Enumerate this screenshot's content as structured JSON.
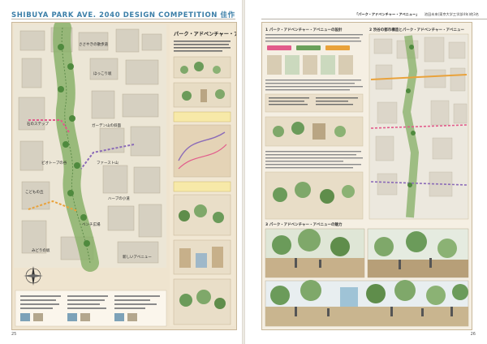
{
  "header": {
    "left_title": "SHIBUYA PARK AVE. 2040 DESIGN COMPETITION 佳作",
    "right_title": "「パーク・アドベンチャー・アベニュー」",
    "right_team": "池田未来(東京大学工学部4年)他3名"
  },
  "footer": {
    "left_page": "25",
    "right_page": "26"
  },
  "left_board": {
    "title": "パーク・アドベンチャー・アベニュー",
    "map_labels": {
      "a": "ささやきの散歩道",
      "b": "ほっこり坂",
      "c": "石のステップ",
      "d": "ガーデン山の斜面",
      "e": "ビオトープの谷",
      "f": "ファースト山",
      "g": "こどもの丘",
      "h": "ハーブの小道",
      "i": "ベンチ広場",
      "j": "みどりの坂",
      "k": "新しいアベニュー"
    }
  },
  "right_board": {
    "section1_title": "1 パーク・アドベンチャー・アベニューの設計",
    "section2_title": "2 渋谷の都市構造とパーク・アドベンチャー・アベニュー",
    "section3_title": "3 パーク・アドベンチャー・アベニューの魅力"
  },
  "colors": {
    "header_blue": "#3c7fa8",
    "board_tan": "#efe4cf",
    "panel_bg": "#fbf6ec",
    "accent_pink": "#e25b8b",
    "accent_purple": "#8b6bb8",
    "accent_orange": "#e9a23b",
    "accent_green": "#6aa05a"
  }
}
